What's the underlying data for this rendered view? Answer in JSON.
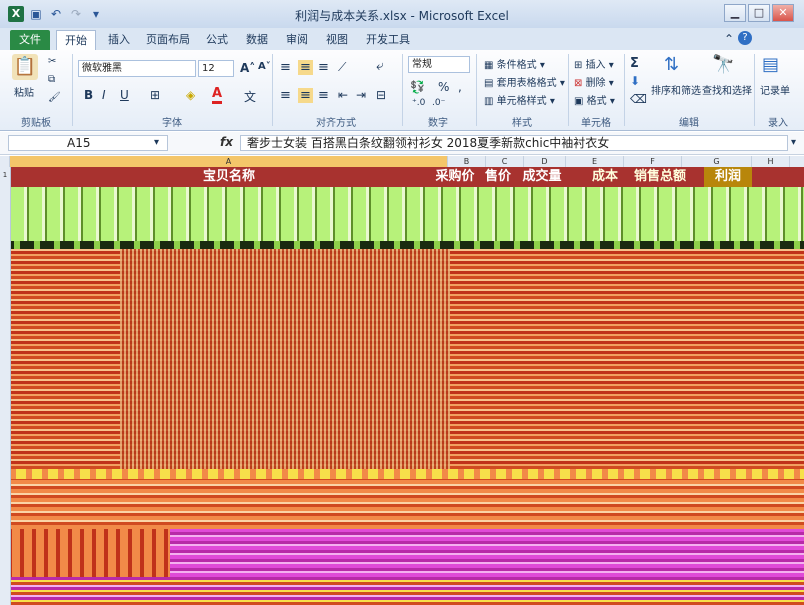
{
  "window": {
    "title": "利润与成本关系.xlsx - Microsoft Excel",
    "app_icon": "excel-icon"
  },
  "ribbon": {
    "tabs": [
      "文件",
      "开始",
      "插入",
      "页面布局",
      "公式",
      "数据",
      "审阅",
      "视图",
      "开发工具"
    ],
    "active_tab": "开始",
    "clipboard": {
      "paste": "粘贴",
      "label": "剪贴板"
    },
    "font": {
      "name": "微软雅黑",
      "size": "12",
      "label": "字体",
      "bold": "B",
      "italic": "I",
      "underline": "U"
    },
    "alignment": {
      "label": "对齐方式"
    },
    "number": {
      "format": "常规",
      "percent": "%",
      "comma": ",",
      "label": "数字"
    },
    "styles": {
      "conditional": "条件格式",
      "table": "套用表格格式",
      "cell": "单元格样式",
      "label": "样式"
    },
    "cells": {
      "insert": "插入",
      "delete": "删除",
      "format": "格式",
      "label": "单元格"
    },
    "editing": {
      "sigma": "Σ",
      "sort": "排序和筛选",
      "find": "查找和选择",
      "label": "编辑"
    },
    "record": {
      "btn": "记录单",
      "label": "录入"
    }
  },
  "formula_bar": {
    "name_box": "A15",
    "fx": "fx",
    "content": "奢步士女装 百搭黑白条纹翻领衬衫女 2018夏季新款chic中袖衬衣女"
  },
  "sheet": {
    "columns": [
      "A",
      "B",
      "C",
      "D",
      "E",
      "F",
      "G",
      "H"
    ],
    "selected_column": "A",
    "first_row": "1",
    "header_row": [
      "宝贝名称",
      "采购价",
      "售价",
      "成交量",
      "成本",
      "销售总额",
      "利润"
    ]
  },
  "colors": {
    "header_row": "#a8322f",
    "band_green": "#b7f27a",
    "band_red": "#d04a20",
    "band_orange": "#f28a48",
    "band_magenta": "#e04ad8",
    "accent_file": "#2a8a45"
  }
}
